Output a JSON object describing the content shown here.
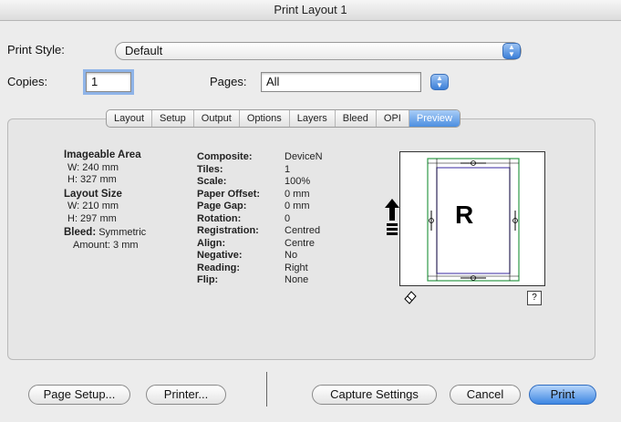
{
  "window": {
    "title": "Print Layout 1"
  },
  "print_style": {
    "label": "Print Style:",
    "value": "Default"
  },
  "copies": {
    "label": "Copies:",
    "value": "1"
  },
  "pages": {
    "label": "Pages:",
    "value": "All"
  },
  "tabs": [
    "Layout",
    "Setup",
    "Output",
    "Options",
    "Layers",
    "Bleed",
    "OPI",
    "Preview"
  ],
  "active_tab": "Preview",
  "left_info": {
    "imageable_area": {
      "title": "Imageable Area",
      "w": "W: 240 mm",
      "h": "H: 327 mm"
    },
    "layout_size": {
      "title": "Layout Size",
      "w": "W: 210 mm",
      "h": "H: 297 mm"
    },
    "bleed": {
      "label": "Bleed:",
      "value": "Symmetric",
      "amount": "Amount: 3 mm"
    }
  },
  "settings": [
    {
      "key": "Composite:",
      "value": "DeviceN"
    },
    {
      "key": "Tiles:",
      "value": "1"
    },
    {
      "key": "Scale:",
      "value": "100%"
    },
    {
      "key": "Paper Offset:",
      "value": "0 mm"
    },
    {
      "key": "Page Gap:",
      "value": "0 mm"
    },
    {
      "key": "Rotation:",
      "value": "0"
    },
    {
      "key": "Registration:",
      "value": "Centred"
    },
    {
      "key": "Align:",
      "value": "Centre"
    },
    {
      "key": "Negative:",
      "value": "No"
    },
    {
      "key": "Reading:",
      "value": "Right"
    },
    {
      "key": "Flip:",
      "value": "None"
    }
  ],
  "preview": {
    "page_letter": "R",
    "help": "?"
  },
  "buttons": {
    "page_setup": "Page Setup...",
    "printer": "Printer...",
    "capture": "Capture Settings",
    "cancel": "Cancel",
    "print": "Print"
  },
  "colors": {
    "accent": "#3d86e2",
    "preview_green": "#2e9a48",
    "preview_purple": "#5a4cb0"
  }
}
